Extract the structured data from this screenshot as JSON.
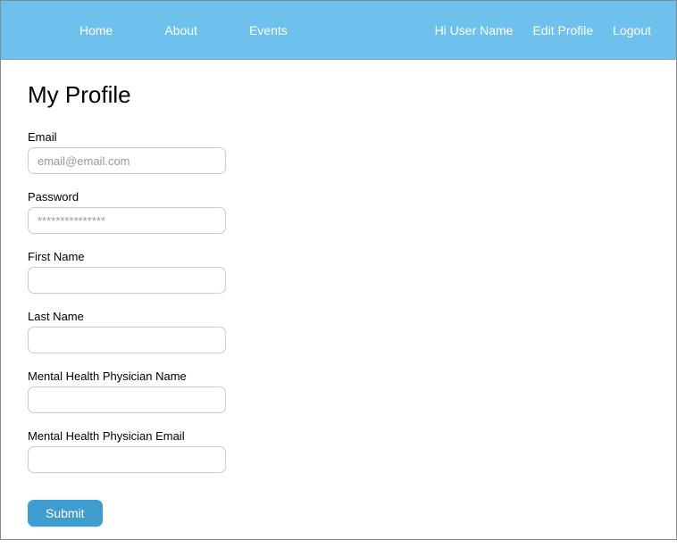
{
  "nav": {
    "left": {
      "home": "Home",
      "about": "About",
      "events": "Events"
    },
    "right": {
      "greeting": "Hi User Name",
      "editProfile": "Edit Profile",
      "logout": "Logout"
    }
  },
  "page": {
    "title": "My Profile"
  },
  "form": {
    "email": {
      "label": "Email",
      "placeholder": "email@email.com",
      "value": ""
    },
    "password": {
      "label": "Password",
      "placeholder": "***************",
      "value": ""
    },
    "firstName": {
      "label": "First Name",
      "value": ""
    },
    "lastName": {
      "label": "Last Name",
      "value": ""
    },
    "physicianName": {
      "label": "Mental Health Physician Name",
      "value": ""
    },
    "physicianEmail": {
      "label": "Mental Health Physician Email",
      "value": ""
    },
    "submitLabel": "Submit"
  }
}
